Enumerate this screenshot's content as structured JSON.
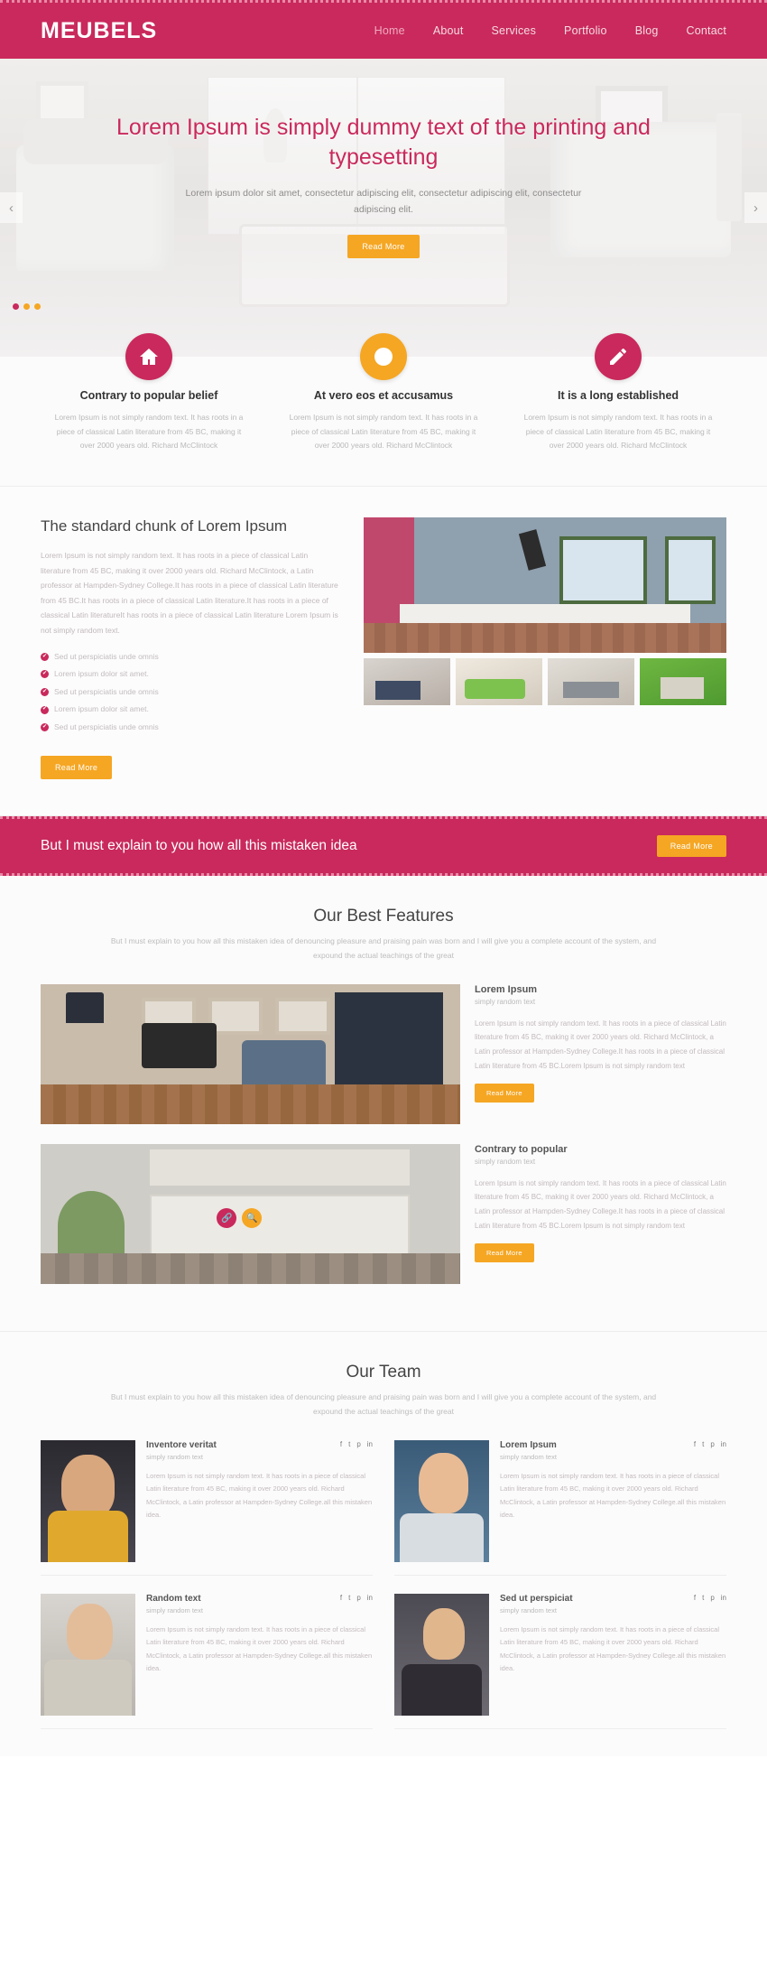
{
  "header": {
    "logo": "MEUBELS",
    "nav": [
      {
        "label": "Home",
        "active": true
      },
      {
        "label": "About",
        "active": false
      },
      {
        "label": "Services",
        "active": false
      },
      {
        "label": "Portfolio",
        "active": false
      },
      {
        "label": "Blog",
        "active": false
      },
      {
        "label": "Contact",
        "active": false
      }
    ]
  },
  "hero": {
    "title": "Lorem Ipsum is simply dummy text of the printing and typesetting",
    "subtitle": "Lorem ipsum dolor sit amet, consectetur adipiscing elit, consectetur adipiscing elit, consectetur adipiscing elit.",
    "button": "Read More",
    "prev_arrow": "‹",
    "next_arrow": "›"
  },
  "features": [
    {
      "icon": "home-icon",
      "color": "#c9295c",
      "title": "Contrary to popular belief",
      "text": "Lorem Ipsum is not simply random text. It has roots in a piece of classical Latin literature from 45 BC, making it over 2000 years old. Richard McClintock"
    },
    {
      "icon": "clock-icon",
      "color": "#f5a623",
      "title": "At vero eos et accusamus",
      "text": "Lorem Ipsum is not simply random text. It has roots in a piece of classical Latin literature from 45 BC, making it over 2000 years old. Richard McClintock"
    },
    {
      "icon": "edit-icon",
      "color": "#c9295c",
      "title": "It is a long established",
      "text": "Lorem Ipsum is not simply random text. It has roots in a piece of classical Latin literature from 45 BC, making it over 2000 years old. Richard McClintock"
    }
  ],
  "chunk": {
    "heading": "The standard chunk of Lorem Ipsum",
    "paragraph": "Lorem Ipsum is not simply random text. It has roots in a piece of classical Latin literature from 45 BC, making it over 2000 years old. Richard McClintock, a Latin professor at Hampden-Sydney College.It has roots in a piece of classical Latin literature from 45 BC.It has roots in a piece of classical Latin literature.It has roots in a piece of classical Latin literatureIt has roots in a piece of classical Latin literature Lorem Ipsum is not simply random text.",
    "list": [
      "Sed ut perspiciatis unde omnis",
      "Lorem ipsum dolor sit amet.",
      "Sed ut perspiciatis unde omnis",
      "Lorem ipsum dolor sit amet.",
      "Sed ut perspiciatis unde omnis"
    ],
    "button": "Read More",
    "tick_glyph": "✔"
  },
  "cta": {
    "text": "But I must explain to you how all this mistaken idea",
    "button": "Read More"
  },
  "best": {
    "heading": "Our Best Features",
    "subtext": "But I must explain to you how all this mistaken idea of denouncing pleasure and praising pain was born and I will give you a complete account of the system, and expound the actual teachings of the great",
    "items": [
      {
        "title": "Lorem Ipsum",
        "subtitle": "simply random text",
        "text": "Lorem Ipsum is not simply random text. It has roots in a piece of classical Latin literature from 45 BC, making it over 2000 years old. Richard McClintock, a Latin professor at Hampden-Sydney College.It has roots in a piece of classical Latin literature from 45 BC.Lorem Ipsum is not simply random text",
        "button": "Read More"
      },
      {
        "title": "Contrary to popular",
        "subtitle": "simply random text",
        "text": "Lorem Ipsum is not simply random text. It has roots in a piece of classical Latin literature from 45 BC, making it over 2000 years old. Richard McClintock, a Latin professor at Hampden-Sydney College.It has roots in a piece of classical Latin literature from 45 BC.Lorem Ipsum is not simply random text",
        "button": "Read More"
      }
    ],
    "badges": [
      "link-icon",
      "search-icon"
    ]
  },
  "team": {
    "heading": "Our Team",
    "subtext": "But I must explain to you how all this mistaken idea of denouncing pleasure and praising pain was born and I will give you a complete account of the system, and expound the actual teachings of the great",
    "social": [
      "facebook-icon",
      "twitter-icon",
      "pinterest-icon",
      "linkedin-icon"
    ],
    "social_glyphs": [
      "f",
      "t",
      "p",
      "in"
    ],
    "members": [
      {
        "name": "Inventore veritat",
        "role": "simply random text",
        "text": "Lorem Ipsum is not simply random text. It has roots in a piece of classical Latin literature from 45 BC, making it over 2000 years old. Richard McClintock, a Latin professor at Hampden-Sydney College.all this mistaken idea."
      },
      {
        "name": "Lorem Ipsum",
        "role": "simply random text",
        "text": "Lorem Ipsum is not simply random text. It has roots in a piece of classical Latin literature from 45 BC, making it over 2000 years old. Richard McClintock, a Latin professor at Hampden-Sydney College.all this mistaken idea."
      },
      {
        "name": "Random text",
        "role": "simply random text",
        "text": "Lorem Ipsum is not simply random text. It has roots in a piece of classical Latin literature from 45 BC, making it over 2000 years old. Richard McClintock, a Latin professor at Hampden-Sydney College.all this mistaken idea."
      },
      {
        "name": "Sed ut perspiciat",
        "role": "simply random text",
        "text": "Lorem Ipsum is not simply random text. It has roots in a piece of classical Latin literature from 45 BC, making it over 2000 years old. Richard McClintock, a Latin professor at Hampden-Sydney College.all this mistaken idea."
      }
    ]
  },
  "colors": {
    "brand_pink": "#c9295c",
    "accent_orange": "#f5a623"
  }
}
